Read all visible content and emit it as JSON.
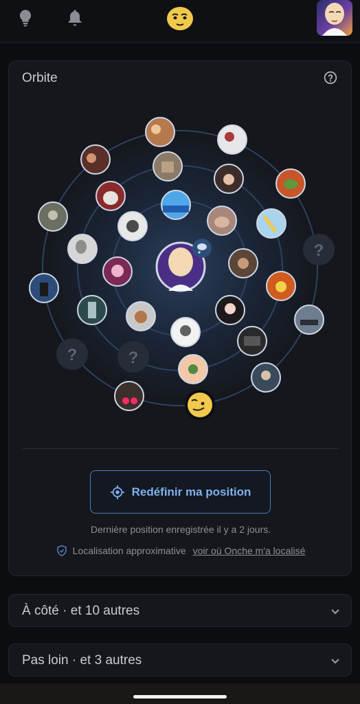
{
  "topbar": {
    "icons": [
      "lightbulb-icon",
      "bell-icon",
      "onche-logo-icon",
      "user-avatar"
    ]
  },
  "orbit": {
    "title": "Orbite",
    "help_icon": "question-circle-icon",
    "unknown_label": "?",
    "reset_button": "Redéfinir ma position",
    "reset_icon": "crosshair-icon",
    "last_position": "Dernière position enregistrée il y a 2 jours.",
    "approx_text": "Localisation approximative",
    "approx_link": "voir où Onche m'a localisé",
    "shield_icon": "shield-check-icon"
  },
  "sections": [
    {
      "label": "À côté · et 10 autres"
    },
    {
      "label": "Pas loin · et 3 autres"
    }
  ],
  "colors": {
    "background": "#0c0d10",
    "card": "#15171c",
    "accent_blue": "#7fb1f0",
    "logo_yellow": "#f2c94c"
  }
}
